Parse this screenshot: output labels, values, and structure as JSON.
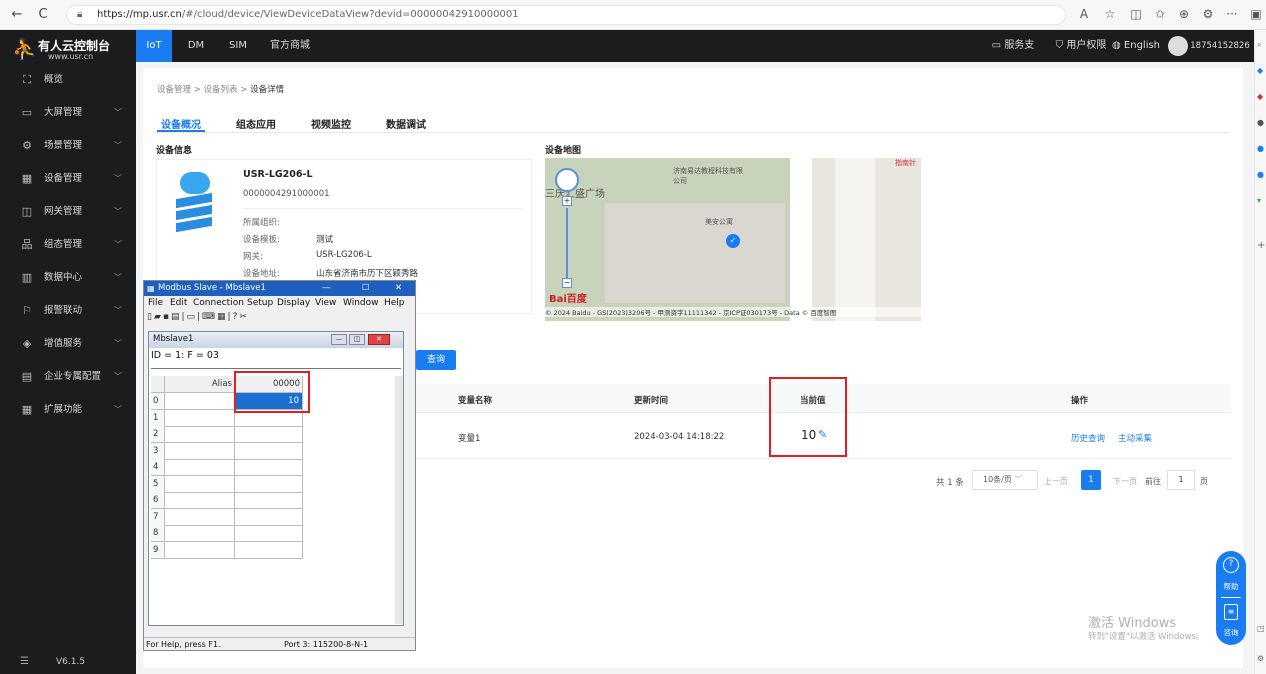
{
  "browser": {
    "url_host": "https://mp.usr.cn",
    "url_path": "/#/cloud/device/ViewDeviceDataView?devid=00000042910000001",
    "back": "←",
    "refresh": "C"
  },
  "brand": {
    "name": "有人云控制台",
    "domain": "www.usr.cn"
  },
  "topnav": {
    "items": [
      "IoT",
      "DM",
      "SIM",
      "官方商城"
    ],
    "right": [
      "服务支持",
      "用户权限",
      "English"
    ],
    "user": "18754152826"
  },
  "sidebar": {
    "items": [
      {
        "icon": "⛶",
        "label": "概览",
        "chevron": ""
      },
      {
        "icon": "▭",
        "label": "大屏管理",
        "chevron": "﹀"
      },
      {
        "icon": "⚙",
        "label": "场景管理",
        "chevron": "﹀"
      },
      {
        "icon": "▦",
        "label": "设备管理",
        "chevron": "﹀"
      },
      {
        "icon": "◫",
        "label": "网关管理",
        "chevron": "﹀"
      },
      {
        "icon": "品",
        "label": "组态管理",
        "chevron": "﹀"
      },
      {
        "icon": "▥",
        "label": "数据中心",
        "chevron": "﹀"
      },
      {
        "icon": "⚐",
        "label": "报警联动",
        "chevron": "﹀"
      },
      {
        "icon": "◈",
        "label": "增值服务",
        "chevron": "﹀"
      },
      {
        "icon": "▤",
        "label": "企业专属配置",
        "chevron": "﹀"
      },
      {
        "icon": "▦",
        "label": "扩展功能",
        "chevron": "﹀"
      }
    ],
    "version": "V6.1.5"
  },
  "breadcrumb": [
    "设备管理",
    "设备列表",
    "设备详情"
  ],
  "tabs": [
    "设备概况",
    "组态应用",
    "视频监控",
    "数据调试"
  ],
  "device_info": {
    "title": "设备信息",
    "name": "USR-LG206-L",
    "id": "0000004291000001",
    "fields": [
      {
        "k": "所属组织:",
        "v": ""
      },
      {
        "k": "设备模板:",
        "v": "测试"
      },
      {
        "k": "网关:",
        "v": "USR-LG206-L"
      },
      {
        "k": "设备地址:",
        "v": "山东省济南市历下区颖秀路"
      }
    ]
  },
  "map": {
    "title": "设备地图",
    "labels": [
      "济南易达教程科技有限公司",
      "三庆汇盛广场",
      "美安公寓",
      "指南针"
    ],
    "copyright": "© 2024 Baidu - GS(2023)3206号 - 甲测资字11111342 - 京ICP证030173号 - Data © 百度智图",
    "logo": "Bai百度"
  },
  "query_button": "查询",
  "table": {
    "headers": [
      "变量名称",
      "更新时间",
      "当前值",
      "操作"
    ],
    "rows": [
      {
        "name": "变量1",
        "time": "2024-03-04 14:18:22",
        "value": "10",
        "actions": [
          "历史查询",
          "主动采集"
        ]
      }
    ]
  },
  "pagination": {
    "total": "共 1 条",
    "page_size": "10条/页",
    "prev": "上一页",
    "current": "1",
    "next": "下一页",
    "goto": "前往",
    "goto_value": "1",
    "page_unit": "页"
  },
  "modbus": {
    "title": "Modbus Slave - Mbslave1",
    "menu": [
      "File",
      "Edit",
      "Connection",
      "Setup",
      "Display",
      "View",
      "Window",
      "Help"
    ],
    "child_title": "Mbslave1",
    "id_line": "ID = 1: F = 03",
    "col_alias": "Alias",
    "col_addr": "00000",
    "rows": [
      "0",
      "1",
      "2",
      "3",
      "4",
      "5",
      "6",
      "7",
      "8",
      "9"
    ],
    "value0": "10",
    "status_left": "For Help, press F1.",
    "status_right": "Port 3: 115200-8-N-1"
  },
  "help": {
    "help": "帮助",
    "consult": "咨询"
  },
  "watermark": {
    "line1": "激活 Windows",
    "line2": "转到\"设置\"以激活 Windows。"
  },
  "colors": {
    "accent": "#1a7cf3",
    "sidebar_bg": "#1b1c1e",
    "highlight": "#e02020"
  }
}
